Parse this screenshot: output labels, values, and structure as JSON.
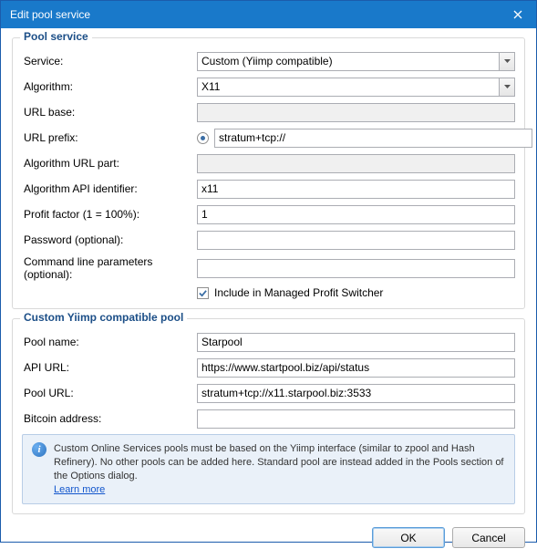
{
  "window": {
    "title": "Edit pool service"
  },
  "groups": {
    "pool_service": {
      "title": "Pool service",
      "labels": {
        "service": "Service:",
        "algorithm": "Algorithm:",
        "url_base": "URL base:",
        "url_prefix": "URL prefix:",
        "algo_url_part": "Algorithm URL part:",
        "algo_api_id": "Algorithm API identifier:",
        "profit_factor": "Profit factor (1 = 100%):",
        "password": "Password (optional):",
        "cmd_params": "Command line parameters (optional):"
      },
      "values": {
        "service": "Custom (Yiimp compatible)",
        "algorithm": "X11",
        "url_base": "",
        "url_prefix1": "stratum+tcp://",
        "url_prefix2": "",
        "algo_url_part": "",
        "algo_api_id": "x11",
        "profit_factor": "1",
        "password": "",
        "cmd_params": ""
      },
      "checkbox_label": "Include in Managed Profit Switcher",
      "checkbox_checked": true
    },
    "custom_pool": {
      "title": "Custom Yiimp compatible pool",
      "labels": {
        "pool_name": "Pool name:",
        "api_url": "API URL:",
        "pool_url": "Pool URL:",
        "bitcoin_addr": "Bitcoin address:"
      },
      "values": {
        "pool_name": "Starpool",
        "api_url": "https://www.startpool.biz/api/status",
        "pool_url": "stratum+tcp://x11.starpool.biz:3533",
        "bitcoin_addr": ""
      },
      "info_text": "Custom Online Services pools must be based on the Yiimp interface (similar to zpool and Hash Refinery). No other pools can be added here. Standard pool are instead added in the Pools section of the Options dialog.",
      "learn_more": "Learn more"
    }
  },
  "buttons": {
    "ok": "OK",
    "cancel": "Cancel"
  }
}
